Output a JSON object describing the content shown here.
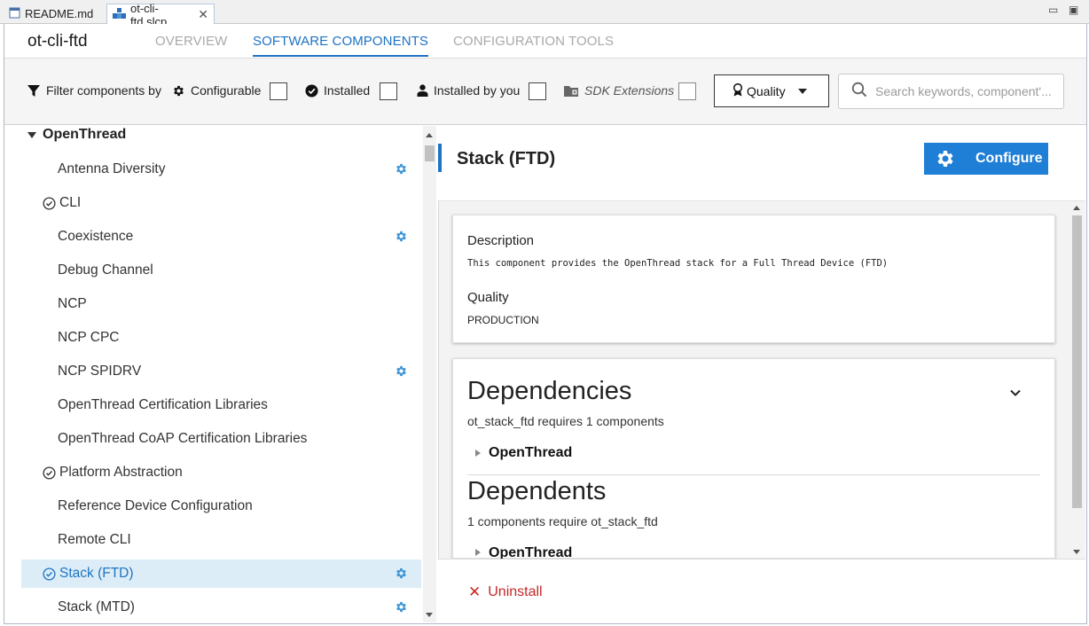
{
  "editor_tabs": [
    {
      "label": "README.md",
      "icon": "document-icon"
    },
    {
      "label": "ot-cli-ftd.slcp",
      "icon": "slcp-project-icon",
      "active": true
    }
  ],
  "window_controls": {
    "minimize": "▭",
    "restore": "▣"
  },
  "project_title": "ot-cli-ftd",
  "nav_tabs": [
    {
      "label": "OVERVIEW",
      "active": false
    },
    {
      "label": "SOFTWARE COMPONENTS",
      "active": true
    },
    {
      "label": "CONFIGURATION TOOLS",
      "active": false
    }
  ],
  "filter": {
    "label": "Filter components by",
    "configurable": "Configurable",
    "installed": "Installed",
    "installed_by_you": "Installed by you",
    "sdk_extensions": "SDK Extensions",
    "quality": "Quality",
    "search_placeholder": "Search keywords, component'..."
  },
  "tree": {
    "root": "OpenThread",
    "items": [
      {
        "label": "Antenna Diversity",
        "installed": false,
        "configurable": true,
        "selected": false
      },
      {
        "label": "CLI",
        "installed": true,
        "configurable": false,
        "selected": false
      },
      {
        "label": "Coexistence",
        "installed": false,
        "configurable": true,
        "selected": false
      },
      {
        "label": "Debug Channel",
        "installed": false,
        "configurable": false,
        "selected": false
      },
      {
        "label": "NCP",
        "installed": false,
        "configurable": false,
        "selected": false
      },
      {
        "label": "NCP CPC",
        "installed": false,
        "configurable": false,
        "selected": false
      },
      {
        "label": "NCP SPIDRV",
        "installed": false,
        "configurable": true,
        "selected": false
      },
      {
        "label": "OpenThread Certification Libraries",
        "installed": false,
        "configurable": false,
        "selected": false
      },
      {
        "label": "OpenThread CoAP Certification Libraries",
        "installed": false,
        "configurable": false,
        "selected": false
      },
      {
        "label": "Platform Abstraction",
        "installed": true,
        "configurable": false,
        "selected": false
      },
      {
        "label": "Reference Device Configuration",
        "installed": false,
        "configurable": false,
        "selected": false
      },
      {
        "label": "Remote CLI",
        "installed": false,
        "configurable": false,
        "selected": false
      },
      {
        "label": "Stack (FTD)",
        "installed": true,
        "configurable": true,
        "selected": true
      },
      {
        "label": "Stack (MTD)",
        "installed": false,
        "configurable": true,
        "selected": false
      }
    ]
  },
  "detail": {
    "title": "Stack (FTD)",
    "configure_label": "Configure",
    "description_label": "Description",
    "description_text": "This component provides the OpenThread stack for a Full Thread Device (FTD)",
    "quality_label": "Quality",
    "quality_value": "PRODUCTION",
    "dependencies_heading": "Dependencies",
    "dependencies_summary": "ot_stack_ftd requires 1 components",
    "dependencies_item": "OpenThread",
    "dependents_heading": "Dependents",
    "dependents_summary": "1 components require ot_stack_ftd",
    "dependents_item": "OpenThread",
    "uninstall_label": "Uninstall"
  },
  "colors": {
    "accent": "#1f73c3",
    "configure_button": "#1f7fd6",
    "selected_row": "#dcedf7",
    "gear": "#3f95d4",
    "uninstall": "#c62828"
  }
}
